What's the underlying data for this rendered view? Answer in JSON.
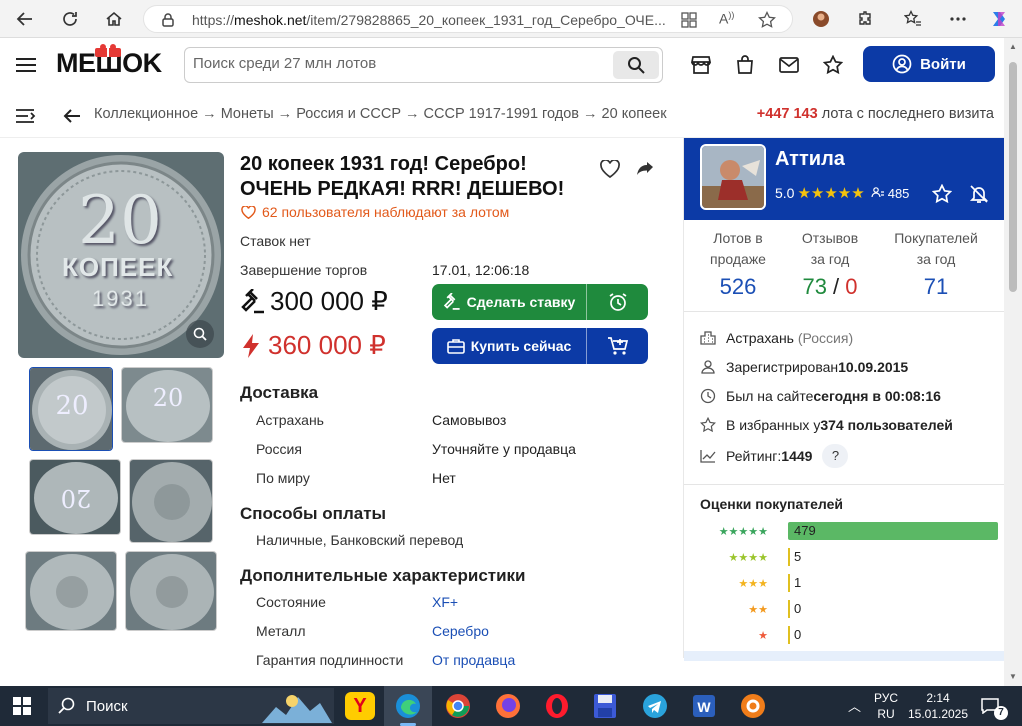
{
  "browser": {
    "url_prefix": "https://",
    "url_domain": "meshok.net",
    "url_path": "/item/279828865_20_копеек_1931_год_Серебро_ОЧЕ..."
  },
  "site": {
    "logo": "MEШOK",
    "search_placeholder": "Поиск среди 27 млн лотов",
    "login_label": "Войти"
  },
  "breadcrumb": {
    "path": "Коллекционное → Монеты → Россия и СССР → СССР 1917-1991 годов → 20 копеек",
    "new_lots_count": "+447 143",
    "new_lots_text": " лота с последнего визита"
  },
  "lot": {
    "title": "20 копеек 1931 год! Серебро! ОЧЕНЬ РЕДКАЯ! RRR! ДЕШЕВО!",
    "watchers": "62 пользователя наблюдают за лотом",
    "bids_status": "Ставок нет",
    "end_label": "Завершение торгов",
    "end_date": "17.01, 12:06:18",
    "current_price": "300 000 ₽",
    "buy_now_price": "360 000 ₽",
    "bid_button": "Сделать ставку",
    "buy_button": "Купить сейчас",
    "coin_denomination": "20",
    "coin_word": "КОПЕЕК",
    "coin_year": "1931"
  },
  "delivery": {
    "title": "Доставка",
    "rows": [
      {
        "k": "Астрахань",
        "v": "Самовывоз"
      },
      {
        "k": "Россия",
        "v": "Уточняйте у продавца"
      },
      {
        "k": "По миру",
        "v": "Нет"
      }
    ]
  },
  "payment": {
    "title": "Способы оплаты",
    "text": "Наличные, Банковский перевод"
  },
  "extra": {
    "title": "Дополнительные характеристики",
    "rows": [
      {
        "k": "Состояние",
        "v": "XF+"
      },
      {
        "k": "Металл",
        "v": "Серебро"
      },
      {
        "k": "Гарантия подлинности",
        "v": "От продавца"
      }
    ]
  },
  "seller": {
    "name": "Аттила",
    "rating": "5.0",
    "reviews_badge": "485",
    "stats": [
      {
        "label1": "Лотов в",
        "label2": "продаже",
        "value": "526"
      },
      {
        "label1": "Отзывов",
        "label2": "за год",
        "value_pos": "73",
        "value_sep": " / ",
        "value_neg": "0"
      },
      {
        "label1": "Покупателей",
        "label2": "за год",
        "value": "71"
      }
    ],
    "city": "Астрахань",
    "country": "(Россия)",
    "registered_label": "Зарегистрирован ",
    "registered_date": "10.09.2015",
    "seen_label": "Был на сайте ",
    "seen_value": "сегодня в 00:08:16",
    "fav_label": "В избранных у ",
    "fav_value": "374 пользователей",
    "score_label": "Рейтинг: ",
    "score_value": "1449",
    "help": "?",
    "ratings_title": "Оценки покупателей",
    "ratings": [
      {
        "stars": "★★★★★",
        "count": "479",
        "fraction": 0.979
      },
      {
        "stars": "★★★★",
        "count": "5",
        "fraction": 0.01
      },
      {
        "stars": "★★★",
        "count": "1",
        "fraction": 0.002
      },
      {
        "stars": "★★",
        "count": "0",
        "fraction": 0
      },
      {
        "stars": "★",
        "count": "0",
        "fraction": 0
      }
    ]
  },
  "taskbar": {
    "search_label": "Поиск",
    "lang1": "РУС",
    "lang2": "RU",
    "time": "2:14",
    "date": "15.01.2025",
    "notif_count": "7"
  },
  "colors": {
    "brand_blue": "#0c3aa6",
    "bid_green": "#1f8a3d",
    "price_red": "#d0312d",
    "watch_orange": "#e2591a"
  }
}
